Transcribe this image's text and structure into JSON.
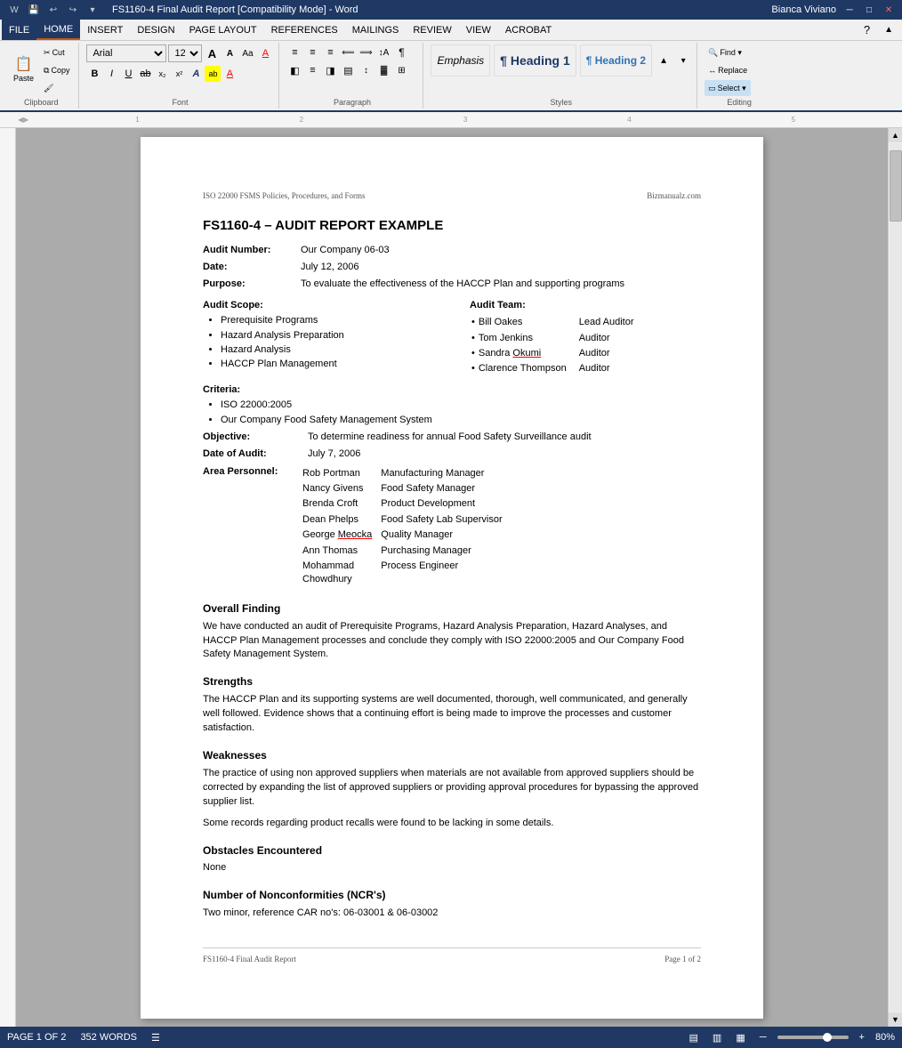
{
  "titleBar": {
    "title": "FS1160-4 Final Audit Report [Compatibility Mode] - Word",
    "user": "Bianca Viviano",
    "winBtns": [
      "─",
      "□",
      "✕"
    ]
  },
  "menuBar": {
    "items": [
      "FILE",
      "HOME",
      "INSERT",
      "DESIGN",
      "PAGE LAYOUT",
      "REFERENCES",
      "MAILINGS",
      "REVIEW",
      "VIEW",
      "ACROBAT"
    ],
    "active": "HOME"
  },
  "ribbon": {
    "clipboard": {
      "label": "Clipboard",
      "paste": "Paste",
      "cut": "✂",
      "copy": "⧉",
      "painter": "🖌"
    },
    "font": {
      "label": "Font",
      "name": "Arial",
      "size": "12",
      "grow": "A",
      "shrink": "A",
      "case": "Aa",
      "clear": "A",
      "bold": "B",
      "italic": "I",
      "underline": "U",
      "strikethrough": "abc",
      "subscript": "x₂",
      "superscript": "x²",
      "textEffect": "A",
      "highlight": "ab",
      "fontColor": "A"
    },
    "paragraph": {
      "label": "Paragraph",
      "bullets": "≡",
      "numbering": "≡",
      "indent_dec": "⟸",
      "indent_inc": "⟹",
      "sort": "↕A",
      "show_marks": "¶",
      "align_left": "≡",
      "align_center": "≡",
      "align_right": "≡",
      "justify": "≡",
      "line_spacing": "↕",
      "shading": "🔲",
      "borders": "⊞"
    },
    "styles": {
      "label": "Styles",
      "items": [
        "Emphasis",
        "¶ Heading 1",
        "¶ Heading 2"
      ]
    },
    "editing": {
      "label": "Editing",
      "find": "Find ▾",
      "replace": "Replace",
      "select": "Select ▾"
    }
  },
  "document": {
    "header_left": "ISO 22000 FSMS Policies, Procedures, and Forms",
    "header_right": "Bizmanualz.com",
    "title": "FS1160-4 – AUDIT REPORT EXAMPLE",
    "fields": [
      {
        "label": "Audit Number:",
        "value": "Our Company 06-03"
      },
      {
        "label": "Date:",
        "value": "July 12, 2006"
      },
      {
        "label": "Purpose:",
        "value": "To evaluate the effectiveness of the HACCP Plan and supporting programs"
      }
    ],
    "audit_scope_label": "Audit Scope:",
    "audit_scope_items": [
      "Prerequisite Programs",
      "Hazard Analysis Preparation",
      "Hazard Analysis",
      "HACCP Plan Management"
    ],
    "audit_team_label": "Audit Team:",
    "audit_team_items": [
      {
        "name": "Bill Oakes",
        "role": "Lead Auditor"
      },
      {
        "name": "Tom Jenkins",
        "role": "Auditor"
      },
      {
        "name": "Sandra Okumi",
        "role": "Auditor",
        "underline": true
      },
      {
        "name": "Clarence Thompson",
        "role": "Auditor"
      }
    ],
    "criteria_label": "Criteria:",
    "criteria_items": [
      "ISO 22000:2005",
      "Our Company Food Safety Management System"
    ],
    "objective_label": "Objective:",
    "objective_value": "To determine readiness for annual Food Safety Surveillance audit",
    "date_of_audit_label": "Date of Audit:",
    "date_of_audit_value": "July 7, 2006",
    "area_personnel_label": "Area Personnel:",
    "area_personnel": [
      {
        "name": "Rob Portman",
        "role": "Manufacturing Manager"
      },
      {
        "name": "Nancy Givens",
        "role": "Food Safety Manager"
      },
      {
        "name": "Brenda Croft",
        "role": "Product Development"
      },
      {
        "name": "Dean Phelps",
        "role": "Food Safety Lab Supervisor"
      },
      {
        "name": "George Meocka",
        "role": "Quality Manager",
        "underline": true
      },
      {
        "name": "Ann Thomas",
        "role": "Purchasing Manager"
      },
      {
        "name": "Mohammad\nChowdhury",
        "role": "Process Engineer"
      }
    ],
    "sections": [
      {
        "heading": "Overall Finding",
        "paragraphs": [
          "We have conducted an audit of Prerequisite Programs, Hazard Analysis Preparation, Hazard Analyses, and HACCP Plan Management processes and conclude they comply with ISO 22000:2005 and Our Company Food Safety Management System."
        ]
      },
      {
        "heading": "Strengths",
        "paragraphs": [
          "The HACCP Plan and its supporting systems are well documented, thorough, well communicated, and generally well followed. Evidence shows that a continuing effort is being made to improve the processes and customer satisfaction."
        ]
      },
      {
        "heading": "Weaknesses",
        "paragraphs": [
          "The practice of using non approved suppliers when materials are not available from approved suppliers should be corrected by expanding the list of approved suppliers or providing approval procedures for bypassing the approved supplier list.",
          "Some records regarding product recalls were found to be lacking in some details."
        ]
      },
      {
        "heading": "Obstacles Encountered",
        "paragraphs": [
          "None"
        ]
      },
      {
        "heading": "Number of Nonconformities (NCR's)",
        "paragraphs": [
          "Two minor, reference CAR no's: 06-03001 & 06-03002"
        ]
      }
    ],
    "footer_left": "FS1160-4 Final Audit Report",
    "footer_right": "Page 1 of 2"
  },
  "statusBar": {
    "page": "PAGE 1 OF 2",
    "words": "352 WORDS",
    "layout_icon": "☰",
    "view_btns": [
      "▤",
      "▥",
      "▦"
    ],
    "zoom": "80%"
  }
}
